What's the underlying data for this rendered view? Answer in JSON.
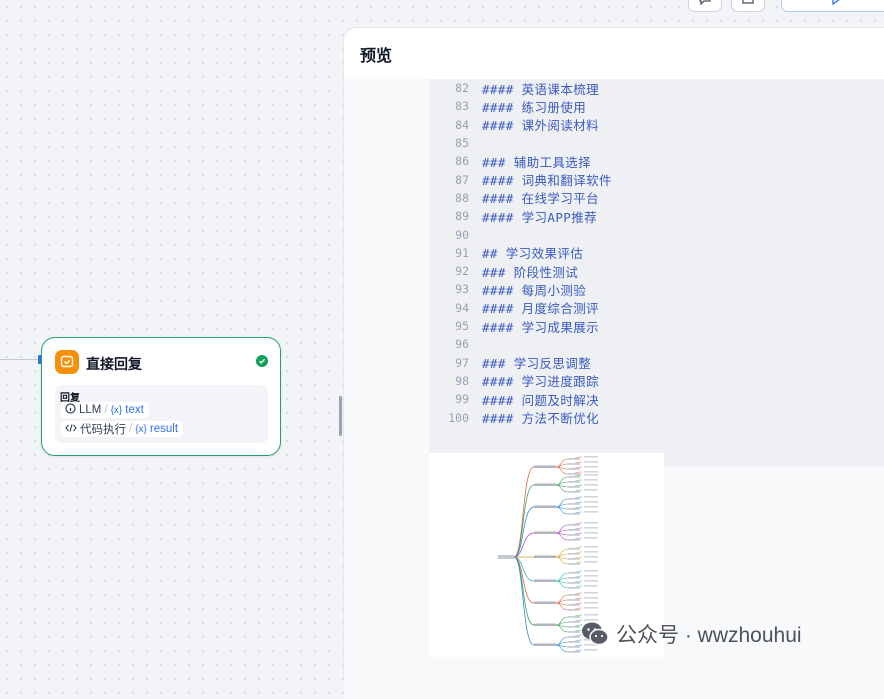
{
  "node": {
    "title": "直接回复",
    "reply_label": "回复",
    "variables": [
      {
        "source": "LLM",
        "var": "text"
      },
      {
        "source": "代码执行",
        "var": "result"
      }
    ],
    "accent_color": "#f79009",
    "status_color": "#12a05a"
  },
  "preview": {
    "title": "预览",
    "code_lines": [
      {
        "num": "82",
        "text": "#### 英语课本梳理"
      },
      {
        "num": "83",
        "text": "#### 练习册使用"
      },
      {
        "num": "84",
        "text": "#### 课外阅读材料"
      },
      {
        "num": "85",
        "text": ""
      },
      {
        "num": "86",
        "text": "### 辅助工具选择"
      },
      {
        "num": "87",
        "text": "#### 词典和翻译软件"
      },
      {
        "num": "88",
        "text": "#### 在线学习平台"
      },
      {
        "num": "89",
        "text": "#### 学习APP推荐"
      },
      {
        "num": "90",
        "text": ""
      },
      {
        "num": "91",
        "text": "## 学习效果评估"
      },
      {
        "num": "92",
        "text": "### 阶段性测试"
      },
      {
        "num": "93",
        "text": "#### 每周小测验"
      },
      {
        "num": "94",
        "text": "#### 月度综合测评"
      },
      {
        "num": "95",
        "text": "#### 学习成果展示"
      },
      {
        "num": "96",
        "text": ""
      },
      {
        "num": "97",
        "text": "### 学习反思调整"
      },
      {
        "num": "98",
        "text": "#### 学习进度跟踪"
      },
      {
        "num": "99",
        "text": "#### 问题及时解决"
      },
      {
        "num": "100",
        "text": "#### 方法不断优化"
      }
    ]
  },
  "watermark": {
    "text": "公众号 · wwzhouhui"
  },
  "icons": [
    "reply-icon",
    "check-circle-icon",
    "info-icon",
    "code-icon",
    "variable-icon",
    "comment-icon",
    "history-icon",
    "play-icon",
    "wechat-icon"
  ]
}
